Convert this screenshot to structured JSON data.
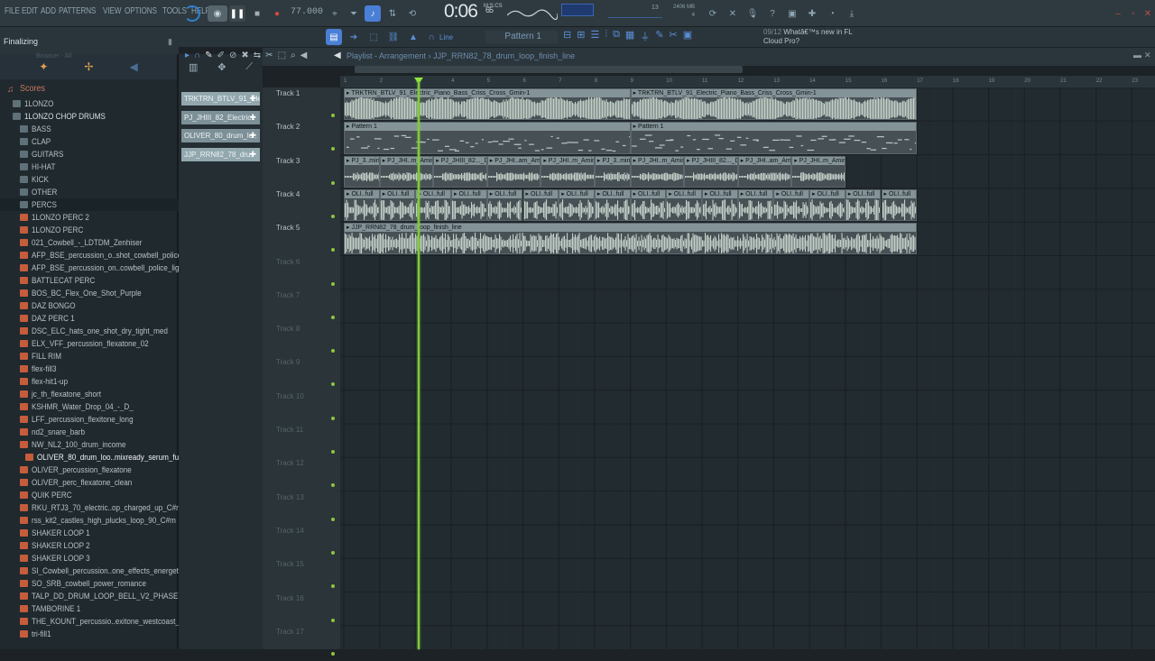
{
  "menu": [
    "FILE",
    "EDIT",
    "ADD",
    "PATTERNS",
    "VIEW",
    "OPTIONS",
    "TOOLS",
    "HELP"
  ],
  "transport": {
    "tempo": "77.000",
    "time_main": "0:06",
    "time_sub": "65",
    "time_unit": "M:S:CS",
    "cpu_line1": "13",
    "cpu_line2": "2406 MB",
    "cpu_line3": "4"
  },
  "hint": "Finalizing",
  "news": {
    "date": "09/12",
    "line1": "Whatâ€™s new in FL",
    "line2": "Cloud Pro?"
  },
  "toolbar2": {
    "pattern": "Pattern 1",
    "snap": "Line"
  },
  "playlist": {
    "title": "Playlist - Arrangement",
    "breadcrumb": "JJP_RRN82_78_drum_loop_finish_line"
  },
  "browser": {
    "title": "Browser - All",
    "items": [
      {
        "type": "scores",
        "label": "Scores",
        "indent": 8
      },
      {
        "type": "folder",
        "label": "1LONZO",
        "indent": 14
      },
      {
        "type": "folder",
        "label": "1LONZO CHOP DRUMS",
        "indent": 14,
        "bold": true
      },
      {
        "type": "folder",
        "label": "BASS",
        "indent": 22
      },
      {
        "type": "folder",
        "label": "CLAP",
        "indent": 22
      },
      {
        "type": "folder",
        "label": "GUITARS",
        "indent": 22
      },
      {
        "type": "folder",
        "label": "HI-HAT",
        "indent": 22
      },
      {
        "type": "folder",
        "label": "KICK",
        "indent": 22
      },
      {
        "type": "folder",
        "label": "OTHER",
        "indent": 22
      },
      {
        "type": "folder",
        "label": "PERCS",
        "indent": 22,
        "sel": true
      },
      {
        "type": "file",
        "label": "1LONZO PERC 2",
        "indent": 22
      },
      {
        "type": "file",
        "label": "1LONZO PERC",
        "indent": 22
      },
      {
        "type": "file",
        "label": "021_Cowbell_-_LDTDM_Zenhiser",
        "indent": 22
      },
      {
        "type": "file",
        "label": "AFP_BSE_percussion_o..shot_cowbell_police",
        "indent": 22
      },
      {
        "type": "file",
        "label": "AFP_BSE_percussion_on..cowbell_police_light",
        "indent": 22
      },
      {
        "type": "file",
        "label": "BATTLECAT PERC",
        "indent": 22
      },
      {
        "type": "file",
        "label": "BOS_BC_Flex_One_Shot_Purple",
        "indent": 22
      },
      {
        "type": "file",
        "label": "DAZ BONGO",
        "indent": 22
      },
      {
        "type": "file",
        "label": "DAZ PERC 1",
        "indent": 22
      },
      {
        "type": "file",
        "label": "DSC_ELC_hats_one_shot_dry_tight_med",
        "indent": 22
      },
      {
        "type": "file",
        "label": "ELX_VFF_percussion_flexatone_02",
        "indent": 22
      },
      {
        "type": "file",
        "label": "FILL RIM",
        "indent": 22
      },
      {
        "type": "file",
        "label": "flex-fill3",
        "indent": 22
      },
      {
        "type": "file",
        "label": "flex-hit1-up",
        "indent": 22
      },
      {
        "type": "file",
        "label": "jc_th_flexatone_short",
        "indent": 22
      },
      {
        "type": "file",
        "label": "KSHMR_Water_Drop_04_-_D_",
        "indent": 22
      },
      {
        "type": "file",
        "label": "LFF_percussion_flexitone_long",
        "indent": 22
      },
      {
        "type": "file",
        "label": "nd2_snare_barb",
        "indent": 22
      },
      {
        "type": "file",
        "label": "NW_NL2_100_drum_income",
        "indent": 22
      },
      {
        "type": "file",
        "label": "OLIVER_80_drum_loo..mixready_serum_full",
        "indent": 28,
        "hl": true
      },
      {
        "type": "file",
        "label": "OLIVER_percussion_flexatone",
        "indent": 22
      },
      {
        "type": "file",
        "label": "OLIVER_perc_flexatone_clean",
        "indent": 22
      },
      {
        "type": "file",
        "label": "QUIK PERC",
        "indent": 22
      },
      {
        "type": "file",
        "label": "RKU_RTJ3_70_electric..op_charged_up_C#min",
        "indent": 22
      },
      {
        "type": "file",
        "label": "rss_kit2_castles_high_plucks_loop_90_C#m",
        "indent": 22
      },
      {
        "type": "file",
        "label": "SHAKER LOOP 1",
        "indent": 22
      },
      {
        "type": "file",
        "label": "SHAKER LOOP 2",
        "indent": 22
      },
      {
        "type": "file",
        "label": "SHAKER LOOP 3",
        "indent": 22
      },
      {
        "type": "file",
        "label": "SI_Cowbell_percussion..one_effects_energetic",
        "indent": 22
      },
      {
        "type": "file",
        "label": "SO_SRB_cowbell_power_romance",
        "indent": 22
      },
      {
        "type": "file",
        "label": "TALP_DD_DRUM_LOOP_BELL_V2_PHASEY_118",
        "indent": 22
      },
      {
        "type": "file",
        "label": "TAMBORINE 1",
        "indent": 22
      },
      {
        "type": "file",
        "label": "THE_KOUNT_percussio..exitone_westcoast_01",
        "indent": 22
      },
      {
        "type": "file",
        "label": "tri-fill1",
        "indent": 22
      }
    ]
  },
  "picker": [
    {
      "label": "TRKTRN_BTLV_91_Ele..",
      "sel": true
    },
    {
      "label": "PJ_JHIII_82_Electric..",
      "sel": false
    },
    {
      "label": "OLIVER_80_drum_lo..",
      "sel": false
    },
    {
      "label": "JJP_RRN82_78_dru..",
      "sel": true
    }
  ],
  "ruler": [
    "1",
    "2",
    "3",
    "4",
    "5",
    "6",
    "7",
    "8",
    "9",
    "10",
    "11",
    "12",
    "13",
    "14",
    "15",
    "16",
    "17",
    "18",
    "19",
    "20",
    "21",
    "22",
    "23"
  ],
  "tracks": [
    "Track 1",
    "Track 2",
    "Track 3",
    "Track 4",
    "Track 5",
    "Track 6",
    "Track 7",
    "Track 8",
    "Track 9",
    "Track 10",
    "Track 11",
    "Track 12",
    "Track 13",
    "Track 14",
    "Track 15",
    "Track 16",
    "Track 17"
  ],
  "clips": [
    {
      "track": 0,
      "start": 1,
      "len": 8,
      "name": "TRKTRN_BTLV_91_Electric_Piano_Bass_Criss_Cross_Gmin-1",
      "kind": "piano"
    },
    {
      "track": 0,
      "start": 9,
      "len": 8,
      "name": "TRKTRN_BTLV_91_Electric_Piano_Bass_Criss_Cross_Gmin-1",
      "kind": "piano"
    },
    {
      "track": 1,
      "start": 1,
      "len": 8,
      "name": "Pattern 1",
      "kind": "pattern"
    },
    {
      "track": 1,
      "start": 9,
      "len": 8,
      "name": "Pattern 1",
      "kind": "pattern"
    },
    {
      "track": 2,
      "start": 1,
      "len": 1,
      "name": "PJ_3..min",
      "kind": "chop"
    },
    {
      "track": 2,
      "start": 2,
      "len": 1.5,
      "name": "PJ_JHI..m_Amin",
      "kind": "chop"
    },
    {
      "track": 2,
      "start": 3.5,
      "len": 1.5,
      "name": "PJ_JHIII_82..._Dream_Amin",
      "kind": "chop"
    },
    {
      "track": 2,
      "start": 5,
      "len": 1.5,
      "name": "PJ_JHI..am_Amin",
      "kind": "chop"
    },
    {
      "track": 2,
      "start": 6.5,
      "len": 1.5,
      "name": "PJ_JHI..m_Amin",
      "kind": "chop"
    },
    {
      "track": 2,
      "start": 8,
      "len": 1,
      "name": "PJ_3..min",
      "kind": "chop"
    },
    {
      "track": 2,
      "start": 9,
      "len": 1.5,
      "name": "PJ_JHI..m_Amin",
      "kind": "chop"
    },
    {
      "track": 2,
      "start": 10.5,
      "len": 1.5,
      "name": "PJ_JHIII_82..._Dream_Amin",
      "kind": "chop"
    },
    {
      "track": 2,
      "start": 12,
      "len": 1.5,
      "name": "PJ_JHI..am_Amin",
      "kind": "chop"
    },
    {
      "track": 2,
      "start": 13.5,
      "len": 1.5,
      "name": "PJ_JHI..m_Amin",
      "kind": "chop"
    },
    {
      "track": 3,
      "start": 1,
      "len": 1,
      "name": "OLI..full",
      "kind": "drum"
    },
    {
      "track": 3,
      "start": 2,
      "len": 1,
      "name": "OLI..full",
      "kind": "drum"
    },
    {
      "track": 3,
      "start": 3,
      "len": 1,
      "name": "OLI..full",
      "kind": "drum"
    },
    {
      "track": 3,
      "start": 4,
      "len": 1,
      "name": "OLI..full",
      "kind": "drum"
    },
    {
      "track": 3,
      "start": 5,
      "len": 1,
      "name": "OLI..full",
      "kind": "drum"
    },
    {
      "track": 3,
      "start": 6,
      "len": 1,
      "name": "OLI..full",
      "kind": "drum"
    },
    {
      "track": 3,
      "start": 7,
      "len": 1,
      "name": "OLI..full",
      "kind": "drum"
    },
    {
      "track": 3,
      "start": 8,
      "len": 1,
      "name": "OLI..full",
      "kind": "drum"
    },
    {
      "track": 3,
      "start": 9,
      "len": 1,
      "name": "OLI..full",
      "kind": "drum"
    },
    {
      "track": 3,
      "start": 10,
      "len": 1,
      "name": "OLI..full",
      "kind": "drum"
    },
    {
      "track": 3,
      "start": 11,
      "len": 1,
      "name": "OLI..full",
      "kind": "drum"
    },
    {
      "track": 3,
      "start": 12,
      "len": 1,
      "name": "OLI..full",
      "kind": "drum"
    },
    {
      "track": 3,
      "start": 13,
      "len": 1,
      "name": "OLI..full",
      "kind": "drum"
    },
    {
      "track": 3,
      "start": 14,
      "len": 1,
      "name": "OLI..full",
      "kind": "drum"
    },
    {
      "track": 3,
      "start": 15,
      "len": 1,
      "name": "OLI..full",
      "kind": "drum"
    },
    {
      "track": 3,
      "start": 16,
      "len": 1,
      "name": "OLI..full",
      "kind": "drum"
    },
    {
      "track": 4,
      "start": 1,
      "len": 16,
      "name": "JJP_RRN82_78_drum_loop_finish_line",
      "kind": "loop"
    }
  ],
  "colors": {
    "playhead": "#7dcc36",
    "clip_header": "#849398",
    "accent": "#4a7fd6",
    "folder_icon": "#5f7078",
    "file_icon": "#c55c3c"
  },
  "icons": [
    "play-icon",
    "stop-icon",
    "record-icon",
    "snap-icon",
    "pencil-icon",
    "paint-icon",
    "delete-icon",
    "mute-icon",
    "slice-icon",
    "select-icon",
    "zoom-icon",
    "playback-icon",
    "magnet-icon",
    "mixer-icon",
    "piano-roll-icon",
    "channel-rack-icon",
    "browser-icon",
    "help-icon",
    "save-icon",
    "chat-icon",
    "download-icon"
  ]
}
